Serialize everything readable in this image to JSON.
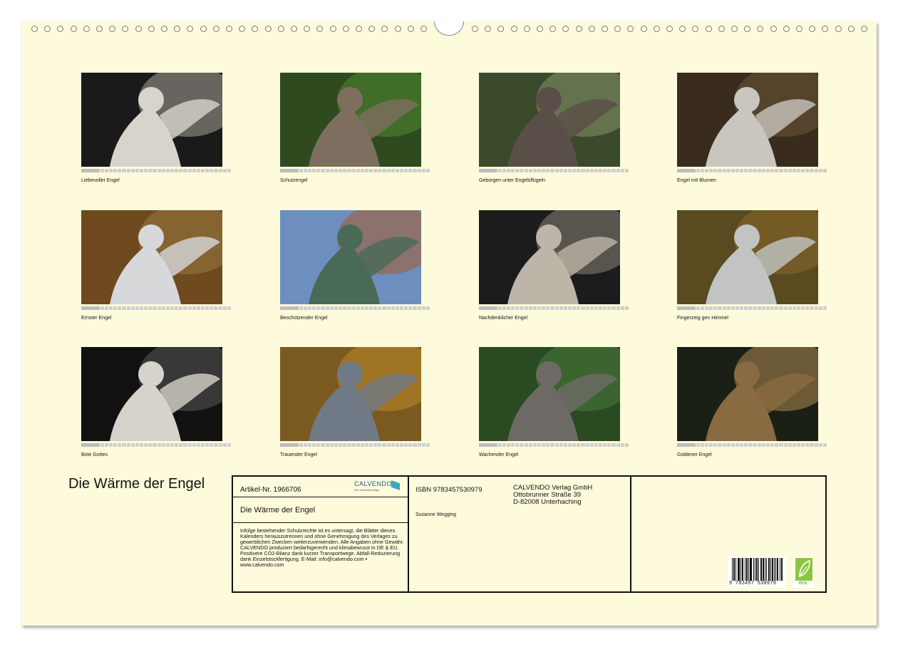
{
  "calendar": {
    "title": "Die Wärme der Engel",
    "months": [
      {
        "caption": "Liebevoller Engel",
        "strip": "Januar"
      },
      {
        "caption": "Schutzengel",
        "strip": "Februar"
      },
      {
        "caption": "Geborgen unter Engelsflügeln",
        "strip": "März"
      },
      {
        "caption": "Engel mit Blumen",
        "strip": "April"
      },
      {
        "caption": "Ernster Engel",
        "strip": "Mai"
      },
      {
        "caption": "Beschützender Engel",
        "strip": "Juni"
      },
      {
        "caption": "Nachdenklicher Engel",
        "strip": "Juli"
      },
      {
        "caption": "Fingerzeig gen Himmel",
        "strip": "August"
      },
      {
        "caption": "Bote Gottes",
        "strip": "September"
      },
      {
        "caption": "Trauender Engel",
        "strip": "Oktober"
      },
      {
        "caption": "Wachender Engel",
        "strip": "November"
      },
      {
        "caption": "Goldener Engel",
        "strip": "Dezember"
      }
    ]
  },
  "imprint": {
    "article_number": "Artikel-Nr. 1966706",
    "logo_text": "CALVENDO",
    "logo_sub": "Der Kalenderverlag",
    "title": "Die Wärme der Engel",
    "legal_text": "Infolge bestehender Schutzrechte ist es untersagt, die Blätter dieses Kalenders herauszutrennen und ohne Genehmigung des Verlages zu gewerblichen Zwecken weiterzuverwenden. Alle Angaben ohne Gewähr. CALVENDO produziert bedarfsgerecht und klimabewusst in DE & EU. Positivere CO2-Bilanz dank kurzer Transportwege. Abfall-Reduzierung dank Einzelstückfertigung. E-Mail: info@calvendo.com • www.calvendo.com",
    "isbn": "ISBN 9783457530979",
    "author": "Susanne Wegging",
    "publisher_line1": "CALVENDO Verlag GmbH",
    "publisher_line2": "Ottobrunner Straße 39",
    "publisher_line3": "D-82008 Unterhaching",
    "barcode_number": "9 783457 530979",
    "eco_label": "eco"
  },
  "colors": {
    "page_background": "#fefbdc",
    "border": "#111111",
    "eco_green": "#8cc63f"
  }
}
